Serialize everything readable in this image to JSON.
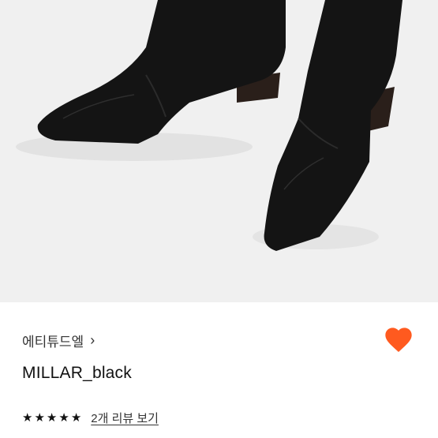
{
  "product": {
    "brand": "에티튜드엘",
    "brand_chevron": "›",
    "name": "MILLAR_black",
    "rating": 5,
    "rating_max": 5,
    "review_link": "2개 리뷰 보기",
    "wishlisted": true
  },
  "colors": {
    "heart": "#ff5a1f",
    "image_bg": "#f0f0f0",
    "boot": "#141414"
  },
  "icons": {
    "wishlist": "heart-icon",
    "star": "star-icon",
    "brand_arrow": "chevron-right-icon"
  }
}
